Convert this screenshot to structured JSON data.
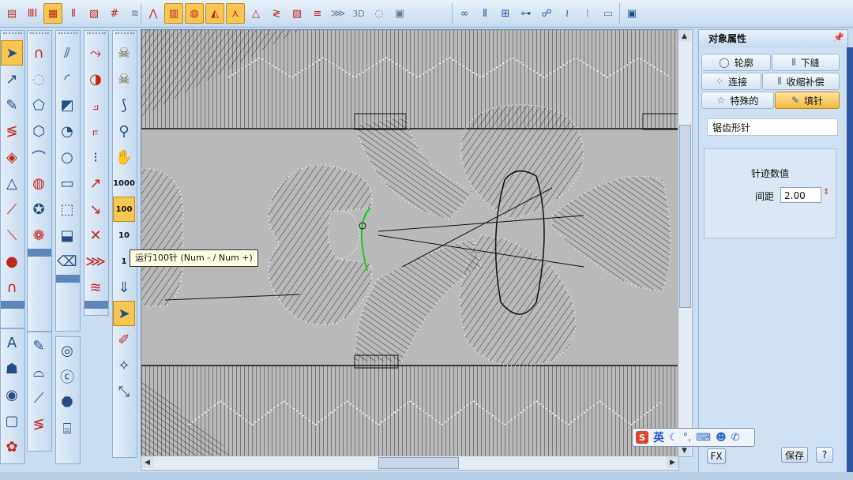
{
  "toolbar": {
    "groups": [
      {
        "items": [
          "satin-icon",
          "steil-icon",
          "fill-icon",
          "tatami-icon",
          "motif-icon",
          "grid-icon",
          "wave-icon"
        ],
        "selected": 2
      },
      {
        "items": [
          "zigzag-fill-icon",
          "circle-fill-icon",
          "radial-fill-icon",
          "triangle-fill-icon",
          "a-shape-icon",
          "wave-stitch-icon",
          "cross-icon",
          "lines-icon",
          "hatch-icon",
          "3d-icon",
          "puff-icon"
        ],
        "selected": [
          1,
          2,
          3,
          4
        ]
      },
      {
        "items": [
          "loops-icon",
          "columns-icon",
          "grid2-icon",
          "chain-icon",
          "curl-icon",
          "pattern-icon",
          "dots-icon"
        ],
        "selected": []
      },
      {
        "items": [
          "monitor-icon"
        ],
        "selected": []
      }
    ],
    "label_3d": "3D"
  },
  "tooltip": {
    "text": "运行100针 (Num - / Num +)"
  },
  "stepper_labels": {
    "s1000": "1000",
    "s100": "100",
    "s10": "10",
    "s1": "1"
  },
  "panel": {
    "title": "对象属性",
    "tabs": [
      {
        "label": "轮廓",
        "icon": "outline-icon"
      },
      {
        "label": "下缝",
        "icon": "underlay-icon"
      },
      {
        "label": "连接",
        "icon": "connect-icon"
      },
      {
        "label": "收缩补偿",
        "icon": "compensation-icon"
      },
      {
        "label": "特殊的",
        "icon": "star-icon"
      },
      {
        "label": "填针",
        "icon": "fill-stitch-icon"
      }
    ],
    "selected_tab": 5,
    "stitch_type": "锯齿形针",
    "group_title": "针迹数值",
    "spacing_label": "间距",
    "spacing_value": "2.00",
    "fx_button": "FX",
    "save_button": "保存",
    "help_button": "?"
  },
  "ime": {
    "logo": "S",
    "lang": "英"
  }
}
